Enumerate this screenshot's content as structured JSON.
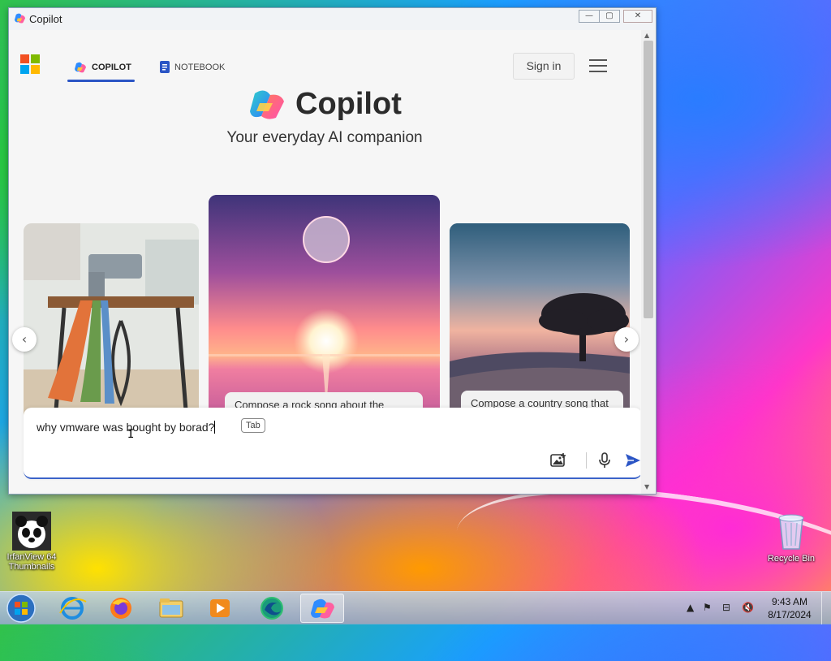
{
  "window": {
    "title": "Copilot",
    "controls": {
      "minimize": "—",
      "maximize": "▢",
      "close": "✕"
    }
  },
  "nav": {
    "tabs": [
      {
        "label": "COPILOT",
        "active": true
      },
      {
        "label": "NOTEBOOK",
        "active": false
      }
    ],
    "sign_in": "Sign in"
  },
  "hero": {
    "brand": "Copilot",
    "tagline": "Your everyday AI companion"
  },
  "cards": [
    {
      "scene": "sewing machine on table with colorful fabric",
      "caption": ""
    },
    {
      "scene": "moon over pink sunset sea",
      "caption": "Compose a rock song about the"
    },
    {
      "scene": "tree on hill at dusk",
      "caption": "Compose a country song that"
    }
  ],
  "composer": {
    "text": "why vmware was bought by borad?",
    "tab_hint": "Tab",
    "tools": [
      "image-upload-icon",
      "microphone-icon",
      "send-icon"
    ]
  },
  "desktop": {
    "icons": [
      {
        "label_line1": "IrfanView 64",
        "label_line2": "Thumbnails"
      },
      {
        "label_line1": "Recycle Bin",
        "label_line2": ""
      }
    ]
  },
  "taskbar": {
    "apps": [
      "internet-explorer-icon",
      "firefox-icon",
      "file-explorer-icon",
      "media-player-icon",
      "edge-icon",
      "copilot-icon"
    ],
    "time": "9:43 AM",
    "date": "8/17/2024"
  },
  "colors": {
    "accent": "#2b55c5",
    "send": "#2b55c5"
  }
}
